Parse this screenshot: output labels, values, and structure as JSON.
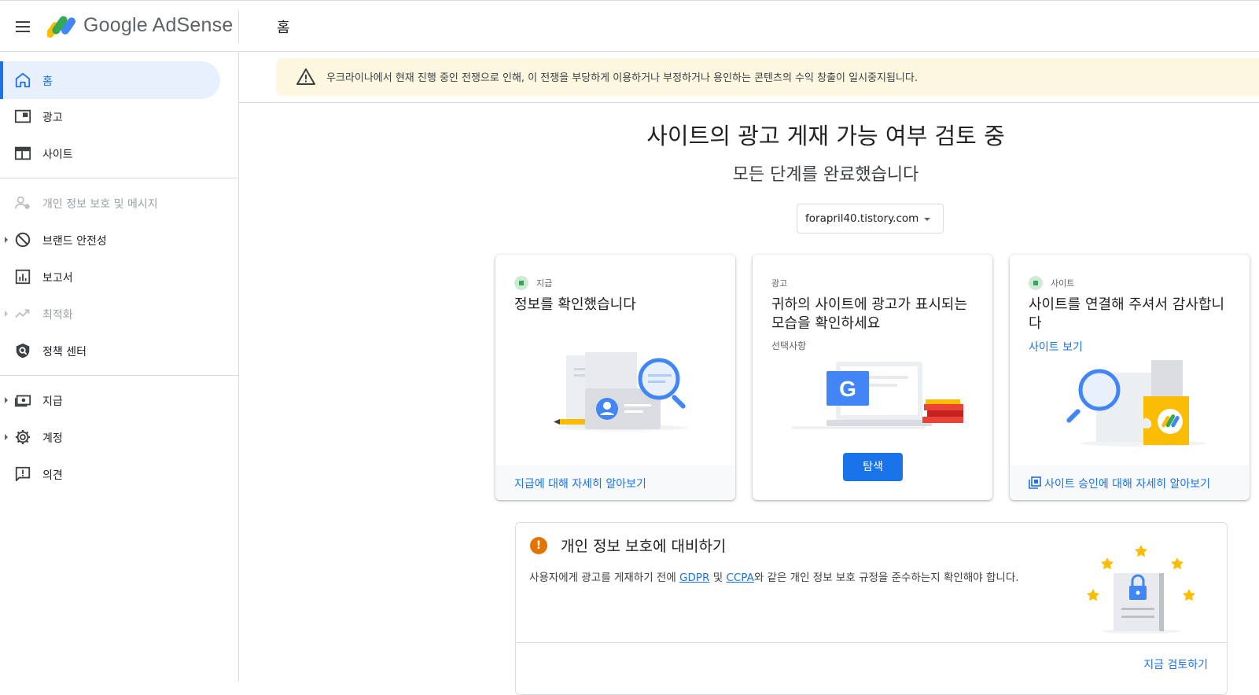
{
  "header": {
    "menu_icon": "hamburger-menu-icon",
    "logo_text": "Google AdSense",
    "page_title": "홈"
  },
  "sidebar": {
    "items": [
      {
        "label": "홈",
        "icon": "home-icon",
        "active": true
      },
      {
        "label": "광고",
        "icon": "ad-unit-icon"
      },
      {
        "label": "사이트",
        "icon": "web-icon"
      },
      {
        "label": "개인 정보 보호 및 메시지",
        "icon": "privacy-icon",
        "disabled": true
      },
      {
        "label": "브랜드 안전성",
        "icon": "block-icon",
        "expandable": true
      },
      {
        "label": "보고서",
        "icon": "bar-chart-icon"
      },
      {
        "label": "최적화",
        "icon": "trending-up-icon",
        "disabled": true,
        "expandable": true
      },
      {
        "label": "정책 센터",
        "icon": "policy-shield-icon"
      },
      {
        "label": "지급",
        "icon": "payments-icon",
        "expandable": true
      },
      {
        "label": "계정",
        "icon": "gear-icon",
        "expandable": true
      },
      {
        "label": "의견",
        "icon": "feedback-icon"
      }
    ]
  },
  "banner": {
    "icon": "warning-icon",
    "text": "우크라이나에서 현재 진행 중인 전쟁으로 인해, 이 전쟁을 부당하게 이용하거나 부정하거나 용인하는 콘텐츠의 수익 창출이 일시중지됩니다."
  },
  "main": {
    "headline": "사이트의 광고 게재 가능 여부 검토 중",
    "subline": "모든 단계를 완료했습니다",
    "site_select": "forapril40.tistory.com"
  },
  "cards": [
    {
      "eyebrow": "지급",
      "title": "정보를 확인했습니다",
      "footer_link": "지급에 대해 자세히 알아보기"
    },
    {
      "eyebrow": "광고",
      "title": "귀하의 사이트에 광고가 표시되는 모습을 확인하세요",
      "subtitle": "선택사항",
      "button": "탐색"
    },
    {
      "eyebrow": "사이트",
      "title": "사이트를 연결해 주셔서 감사합니다",
      "link": "사이트 보기",
      "footer_link": "사이트 승인에 대해 자세히 알아보기"
    }
  ],
  "privacy": {
    "title": "개인 정보 보호에 대비하기",
    "body_prefix": "사용자에게 광고를 게재하기 전에 ",
    "gdpr": "GDPR",
    "and": " 및 ",
    "ccpa": "CCPA",
    "body_suffix": "와 같은 개인 정보 보호 규정을 준수하는지 확인해야 합니다.",
    "action": "지금 검토하기"
  },
  "colors": {
    "accent": "#1a73e8",
    "active_bg": "#e8f0fe",
    "banner_bg": "#fef7e0",
    "success": "#34a853",
    "alert": "#e37400"
  }
}
